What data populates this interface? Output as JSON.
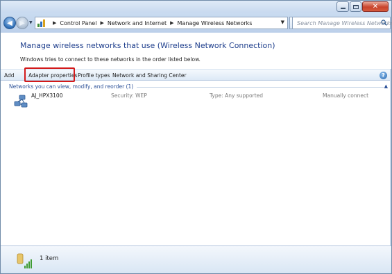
{
  "window": {
    "caption_buttons": [
      "minimize",
      "maximize",
      "close"
    ]
  },
  "navigation": {
    "back_icon": "back-arrow-icon",
    "forward_icon": "forward-arrow-icon",
    "breadcrumbs": [
      "Control Panel",
      "Network and Internet",
      "Manage Wireless Networks"
    ],
    "search_placeholder": "Search Manage Wireless Networks"
  },
  "header": {
    "title": "Manage wireless networks that use (Wireless Network Connection)",
    "subtitle": "Windows tries to connect to these networks in the order listed below."
  },
  "toolbar": {
    "items": [
      "Add",
      "Adapter properties",
      "Profile types",
      "Network and Sharing Center"
    ],
    "highlighted_item": "Adapter properties",
    "highlight_color": "#d3191a"
  },
  "networks": {
    "group_label": "Networks you can view, modify, and reorder (1)",
    "items": [
      {
        "name": "AJ_HPX3100",
        "security": "Security: WEP",
        "type": "Type: Any supported",
        "connect_mode": "Manually connect"
      }
    ]
  },
  "details": {
    "count_text": "1 item"
  },
  "colors": {
    "heading": "#1e3e8c",
    "group_header": "#2a4f97",
    "muted_text": "#7a7a7a"
  }
}
